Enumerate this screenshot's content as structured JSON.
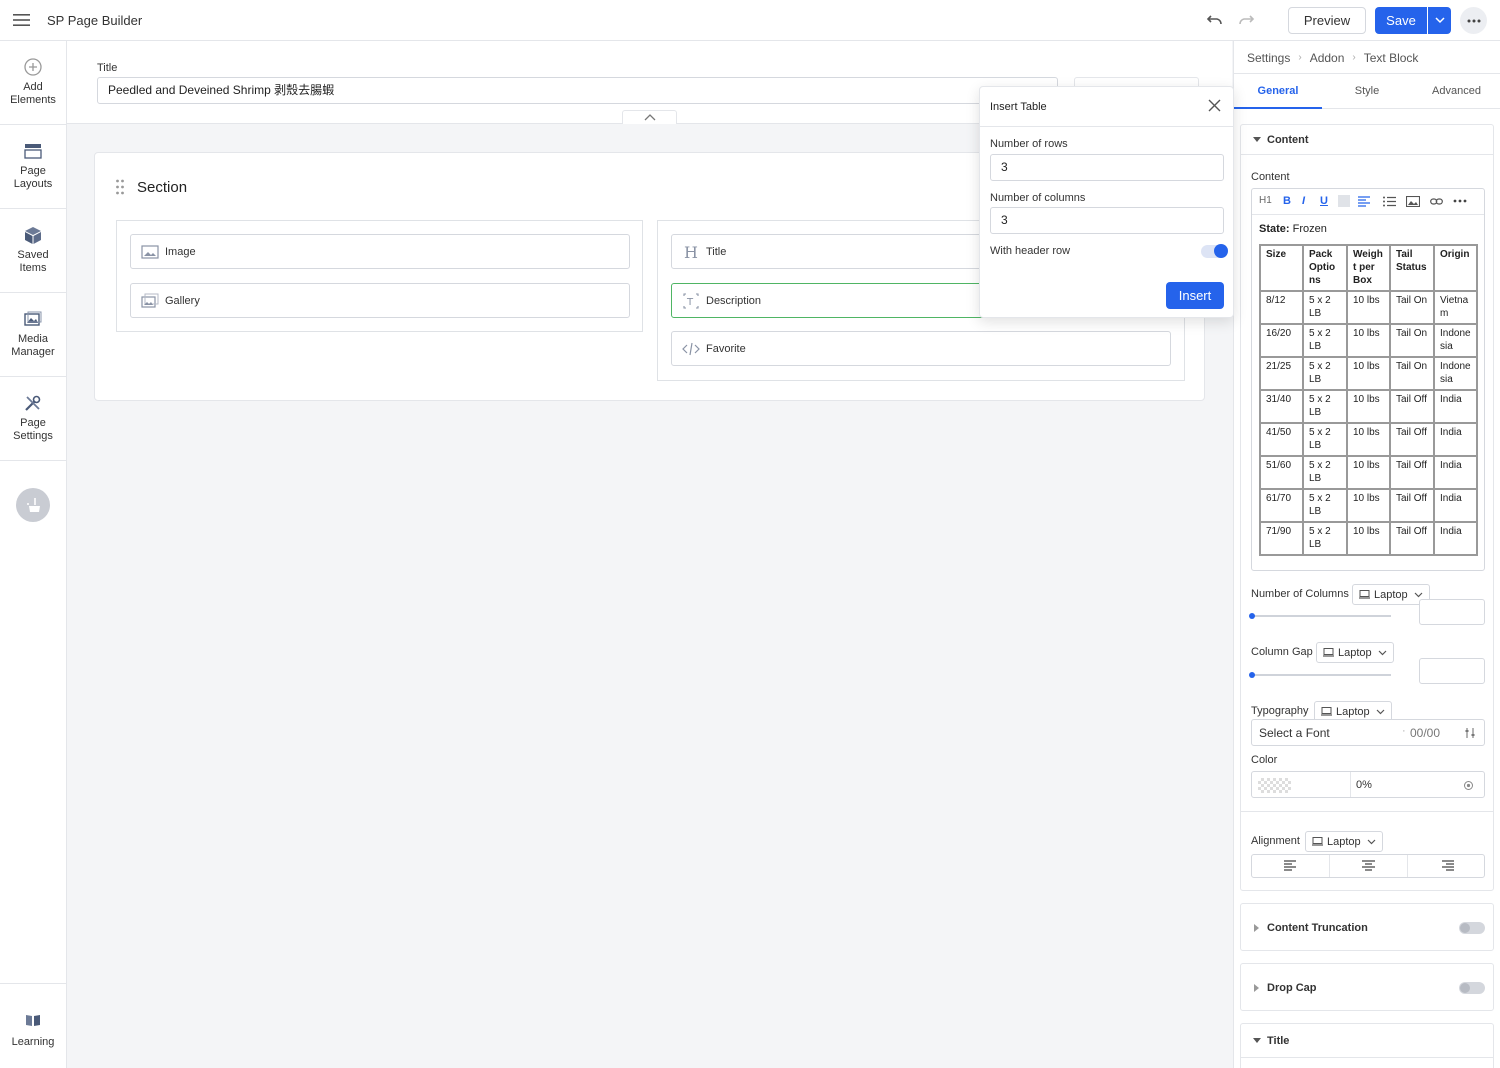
{
  "app": {
    "title": "SP Page Builder"
  },
  "toolbar": {
    "preview_label": "Preview",
    "save_label": "Save"
  },
  "sidebar": {
    "items": [
      {
        "label": "Add Elements",
        "icon": "plus-circle-icon"
      },
      {
        "label": "Page Layouts",
        "icon": "layout-icon"
      },
      {
        "label": "Saved Items",
        "icon": "box-icon"
      },
      {
        "label": "Media Manager",
        "icon": "media-icon"
      },
      {
        "label": "Page Settings",
        "icon": "tools-icon"
      }
    ],
    "learning_label": "Learning"
  },
  "page": {
    "title_label": "Title",
    "title_value": "Peedled and Deveined Shrimp 剥殼去腸蝦"
  },
  "section": {
    "title": "Section",
    "col1": [
      {
        "label": "Image",
        "icon": "image-icon"
      },
      {
        "label": "Gallery",
        "icon": "gallery-icon"
      }
    ],
    "col2": [
      {
        "label": "Title",
        "icon": "heading-icon"
      },
      {
        "label": "Description",
        "icon": "text-icon"
      },
      {
        "label": "Favorite",
        "icon": "code-icon"
      }
    ]
  },
  "insert_table": {
    "title": "Insert Table",
    "rows_label": "Number of rows",
    "rows_value": "3",
    "cols_label": "Number of columns",
    "cols_value": "3",
    "header_label": "With header row",
    "header_on": true,
    "insert_label": "Insert"
  },
  "panel": {
    "breadcrumb": [
      "Settings",
      "Addon",
      "Text Block"
    ],
    "tabs": [
      "General",
      "Style",
      "Advanced"
    ],
    "active_tab": "General",
    "content_group": "Content",
    "content_label": "Content",
    "state_label": "State:",
    "state_value": "Frozen",
    "table": {
      "headers": [
        "Size",
        "Pack Optio ns",
        "Weigh t per Box",
        "Tail Status",
        "Origin"
      ],
      "rows": [
        [
          "8/12",
          "5 x 2 LB",
          "10 lbs",
          "Tail On",
          "Vietna m"
        ],
        [
          "16/20",
          "5 x 2 LB",
          "10 lbs",
          "Tail On",
          "Indone sia"
        ],
        [
          "21/25",
          "5 x 2 LB",
          "10 lbs",
          "Tail On",
          "Indone sia"
        ],
        [
          "31/40",
          "5 x 2 LB",
          "10 lbs",
          "Tail Off",
          "India"
        ],
        [
          "41/50",
          "5 x 2 LB",
          "10 lbs",
          "Tail Off",
          "India"
        ],
        [
          "51/60",
          "5 x 2 LB",
          "10 lbs",
          "Tail Off",
          "India"
        ],
        [
          "61/70",
          "5 x 2 LB",
          "10 lbs",
          "Tail Off",
          "India"
        ],
        [
          "71/90",
          "5 x 2 LB",
          "10 lbs",
          "Tail Off",
          "India"
        ]
      ]
    },
    "num_columns_label": "Number of Columns",
    "column_gap_label": "Column Gap",
    "typography_label": "Typography",
    "device": "Laptop",
    "font_placeholder": "Select a Font",
    "font_size": "00/00",
    "color_label": "Color",
    "color_opacity": "0%",
    "alignment_label": "Alignment",
    "content_truncation": "Content Truncation",
    "drop_cap": "Drop Cap",
    "title_group": "Title"
  },
  "colors": {
    "accent": "#2563eb",
    "active_border": "#4fb564"
  }
}
